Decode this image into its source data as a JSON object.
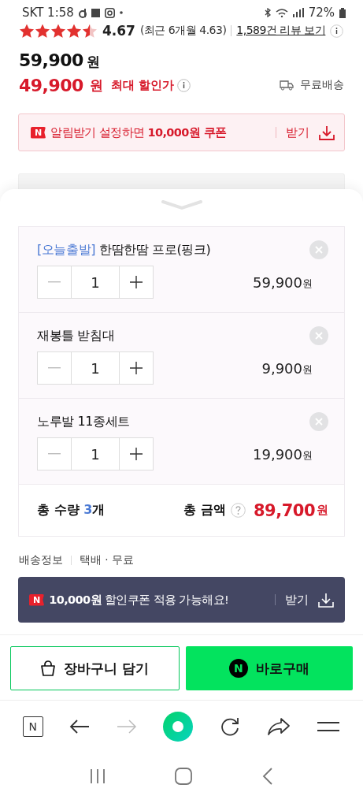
{
  "status_bar": {
    "carrier": "SKT",
    "time": "1:58",
    "battery": "72%"
  },
  "rating": {
    "stars": 4.5,
    "score": "4.67",
    "recent": "(최근 6개월 4.63)",
    "reviews_link": "1,589건 리뷰 보기"
  },
  "price": {
    "original": "59,900",
    "original_unit": "원",
    "sale": "49,900",
    "sale_unit": "원",
    "sale_label": "최대 할인가",
    "shipping": "무료배송"
  },
  "alert_coupon": {
    "badge": "N",
    "text": "알림받기 설정하면 **10,000원 쿠폰**",
    "action": "받기"
  },
  "options": [
    {
      "tag": "[오늘출발]",
      "name": "한땀한땀 프로(핑크)",
      "quantity": "1",
      "price": "59,900",
      "unit": "원"
    },
    {
      "name": "재봉틀 받침대",
      "quantity": "1",
      "price": "9,900",
      "unit": "원"
    },
    {
      "name": "노루발 11종세트",
      "quantity": "1",
      "price": "19,900",
      "unit": "원"
    }
  ],
  "total": {
    "quantity_label": "총 수량",
    "quantity": "3",
    "quantity_unit": "개",
    "amount_label": "총 금액",
    "amount": "89,700",
    "amount_unit": "원"
  },
  "shipping_info": {
    "label": "배송정보",
    "value": "택배 · 무료"
  },
  "discount_banner": {
    "badge": "N",
    "text": "**10,000원** 할인쿠폰 적용 가능해요!",
    "action": "받기"
  },
  "buttons": {
    "cart": "장바구니 담기",
    "buy_badge": "N",
    "buy": "바로구매"
  },
  "browser_nav": {
    "home_badge": "N"
  }
}
